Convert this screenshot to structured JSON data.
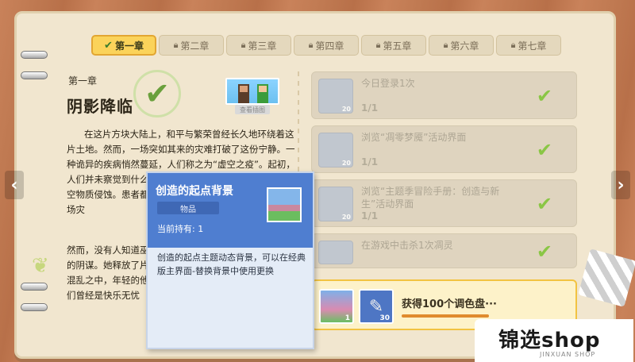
{
  "tabs": [
    {
      "label": "第一章",
      "icon": "check-icon",
      "active": true
    },
    {
      "label": "第二章",
      "icon": "lock-icon",
      "active": false
    },
    {
      "label": "第三章",
      "icon": "lock-icon",
      "active": false
    },
    {
      "label": "第四章",
      "icon": "lock-icon",
      "active": false
    },
    {
      "label": "第五章",
      "icon": "lock-icon",
      "active": false
    },
    {
      "label": "第六章",
      "icon": "lock-icon",
      "active": false
    },
    {
      "label": "第七章",
      "icon": "lock-icon",
      "active": false
    }
  ],
  "chapter": {
    "number": "第一章",
    "title": "阴影降临",
    "image_badge": "查看插图",
    "story": "在这片方块大陆上，和平与繁荣曾经长久地环绕着这片土地。然而，一场突如其来的灾难打破了这份宁静。一种诡异的疾病悄然蔓延，人们称之为“虚空之疫”。起初，人们并未察觉到什么异样，直到人开始出现症状：皮肤虚空物质侵蚀。患者都会化为虚无。恐惧护所，试图逃离这场灾",
    "story_tail": "然而，没有人知道巫的阴谋。她释放了片混乱之中，年轻的他们曾经是快乐无忧"
  },
  "quests": [
    {
      "title": "今日登录1次",
      "progress": "1/1",
      "reward_count": "20"
    },
    {
      "title": "浏览“凋零梦魇”活动界面",
      "progress": "1/1",
      "reward_count": "20"
    },
    {
      "title": "浏览“主题季冒险手册：创造与新生”活动界面",
      "progress": "1/1",
      "reward_count": "20"
    },
    {
      "title": "在游戏中击杀1次凋灵",
      "progress": "",
      "reward_count": ""
    }
  ],
  "reward": {
    "title": "获得100个调色盘···",
    "item1_count": "1",
    "item2_count": "30"
  },
  "tooltip": {
    "name": "创造的起点背景",
    "tag": "物品",
    "owned": "当前持有: 1",
    "description": "创造的起点主题动态背景，可以在经典版主界面-替换背景中使用更换"
  },
  "watermark": {
    "title": "锦选shop",
    "subtitle": "JINXUAN SHOP"
  },
  "colors": {
    "tab_active": "#fbd35a",
    "check_green": "#79c12e",
    "tooltip_header": "#4f7ed0",
    "page_bg": "#f1e6cf"
  }
}
